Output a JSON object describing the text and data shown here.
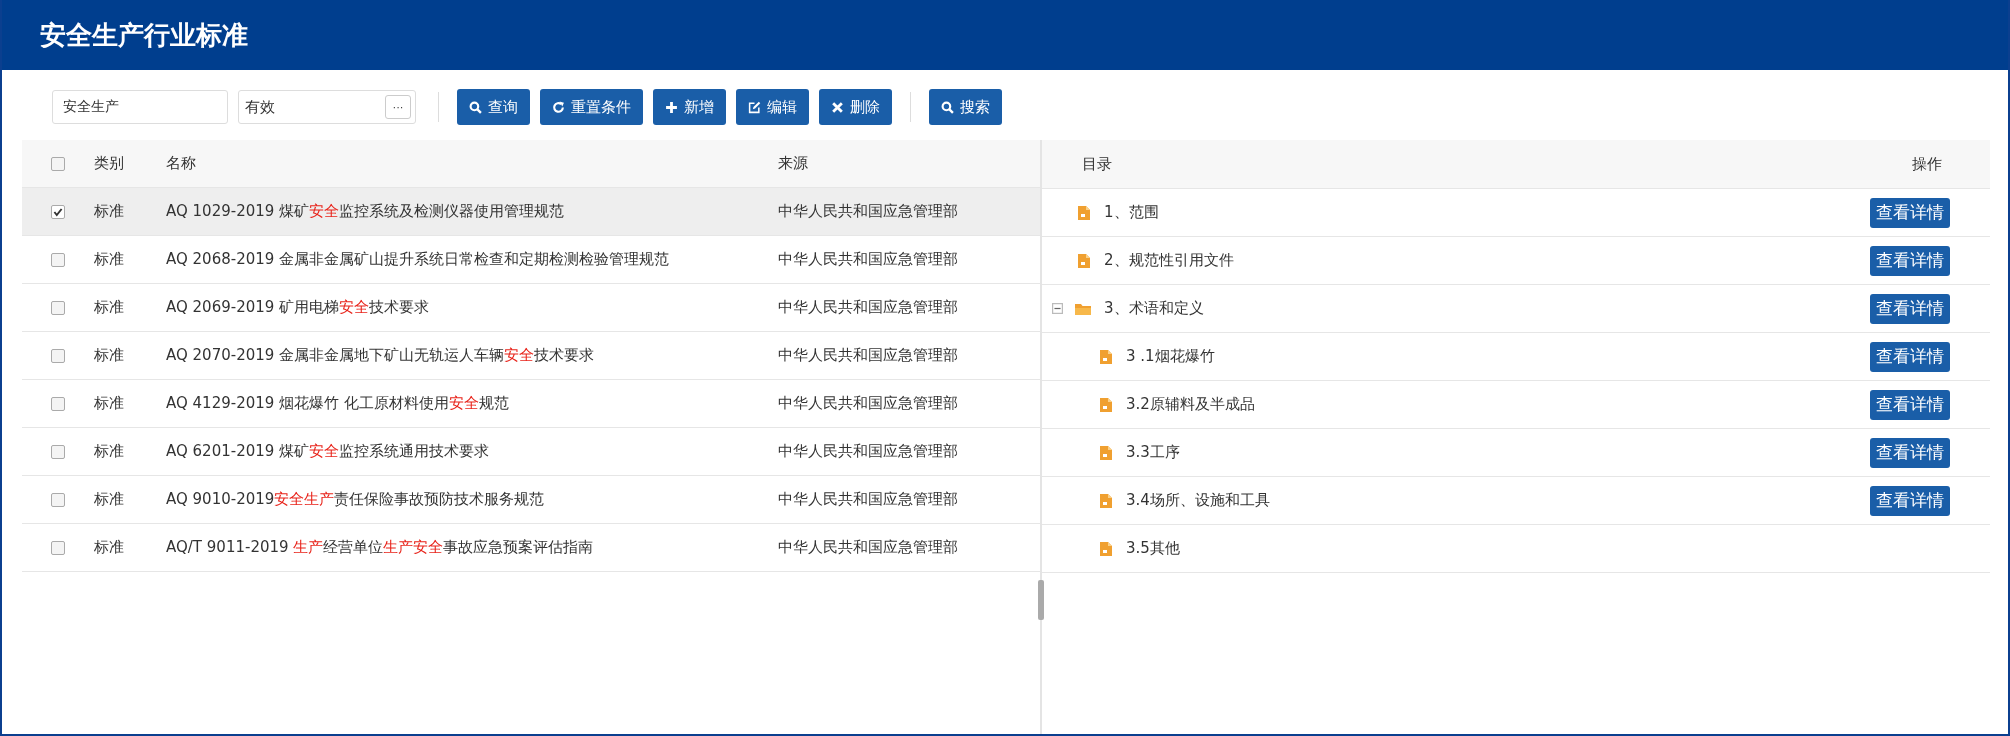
{
  "header": {
    "title": "安全生产行业标准"
  },
  "toolbar": {
    "keyword": {
      "value": "安全生产"
    },
    "status": {
      "value": "有效",
      "button": "···"
    },
    "buttons": [
      {
        "kind": "search",
        "label": "查询"
      },
      {
        "kind": "reset",
        "label": "重置条件"
      },
      {
        "kind": "add",
        "label": "新增"
      },
      {
        "kind": "edit",
        "label": "编辑"
      },
      {
        "kind": "delete",
        "label": "删除"
      },
      {
        "kind": "search",
        "label": "搜索"
      }
    ]
  },
  "standards_table": {
    "select_all": {
      "checked": false
    },
    "columns": [
      "类别",
      "名称",
      "来源"
    ],
    "rows": [
      {
        "checked": true,
        "selected": true,
        "category": "标准",
        "name": [
          {
            "text": "AQ 1029-2019 煤矿",
            "highlight": false
          },
          {
            "text": "安全",
            "highlight": true
          },
          {
            "text": "监控系统及检测仪器使用管理规范",
            "highlight": false
          }
        ],
        "source": "中华人民共和国应急管理部"
      },
      {
        "checked": false,
        "selected": false,
        "category": "标准",
        "name": [
          {
            "text": "AQ 2068-2019 金属非金属矿山提升系统日常检查和定期检测检验管理规范",
            "highlight": false
          }
        ],
        "source": "中华人民共和国应急管理部"
      },
      {
        "checked": false,
        "selected": false,
        "category": "标准",
        "name": [
          {
            "text": "AQ 2069-2019 矿用电梯",
            "highlight": false
          },
          {
            "text": "安全",
            "highlight": true
          },
          {
            "text": "技术要求",
            "highlight": false
          }
        ],
        "source": "中华人民共和国应急管理部"
      },
      {
        "checked": false,
        "selected": false,
        "category": "标准",
        "name": [
          {
            "text": "AQ 2070-2019 金属非金属地下矿山无轨运人车辆",
            "highlight": false
          },
          {
            "text": "安全",
            "highlight": true
          },
          {
            "text": "技术要求",
            "highlight": false
          }
        ],
        "source": "中华人民共和国应急管理部"
      },
      {
        "checked": false,
        "selected": false,
        "category": "标准",
        "name": [
          {
            "text": "AQ 4129-2019 烟花爆竹 化工原材料使用",
            "highlight": false
          },
          {
            "text": "安全",
            "highlight": true
          },
          {
            "text": "规范",
            "highlight": false
          }
        ],
        "source": "中华人民共和国应急管理部"
      },
      {
        "checked": false,
        "selected": false,
        "category": "标准",
        "name": [
          {
            "text": "AQ 6201-2019 煤矿",
            "highlight": false
          },
          {
            "text": "安全",
            "highlight": true
          },
          {
            "text": "监控系统通用技术要求",
            "highlight": false
          }
        ],
        "source": "中华人民共和国应急管理部"
      },
      {
        "checked": false,
        "selected": false,
        "category": "标准",
        "name": [
          {
            "text": "AQ 9010-2019",
            "highlight": false
          },
          {
            "text": "安全生产",
            "highlight": true
          },
          {
            "text": "责任保险事故预防技术服务规范",
            "highlight": false
          }
        ],
        "source": "中华人民共和国应急管理部"
      },
      {
        "checked": false,
        "selected": false,
        "category": "标准",
        "name": [
          {
            "text": "AQ/T 9011-2019 ",
            "highlight": false
          },
          {
            "text": "生产",
            "highlight": true
          },
          {
            "text": "经营单位",
            "highlight": false
          },
          {
            "text": "生产安全",
            "highlight": true
          },
          {
            "text": "事故应急预案评估指南",
            "highlight": false
          }
        ],
        "source": "中华人民共和国应急管理部"
      }
    ]
  },
  "contents_tree": {
    "columns": [
      "目录",
      "操作"
    ],
    "items": [
      {
        "kind": "file",
        "label": "1、范围",
        "action": "查看详情"
      },
      {
        "kind": "file",
        "label": "2、规范性引用文件",
        "action": "查看详情"
      },
      {
        "kind": "folder",
        "label": "3、术语和定义",
        "action": "查看详情",
        "expanded": true,
        "children": [
          {
            "kind": "file",
            "label": "3 .1烟花爆竹",
            "action": "查看详情"
          },
          {
            "kind": "file",
            "label": "3.2原辅料及半成品",
            "action": "查看详情"
          },
          {
            "kind": "file",
            "label": "3.3工序",
            "action": "查看详情"
          },
          {
            "kind": "file",
            "label": "3.4场所、设施和工具",
            "action": "查看详情"
          },
          {
            "kind": "file",
            "label": "3.5其他"
          }
        ]
      }
    ]
  }
}
